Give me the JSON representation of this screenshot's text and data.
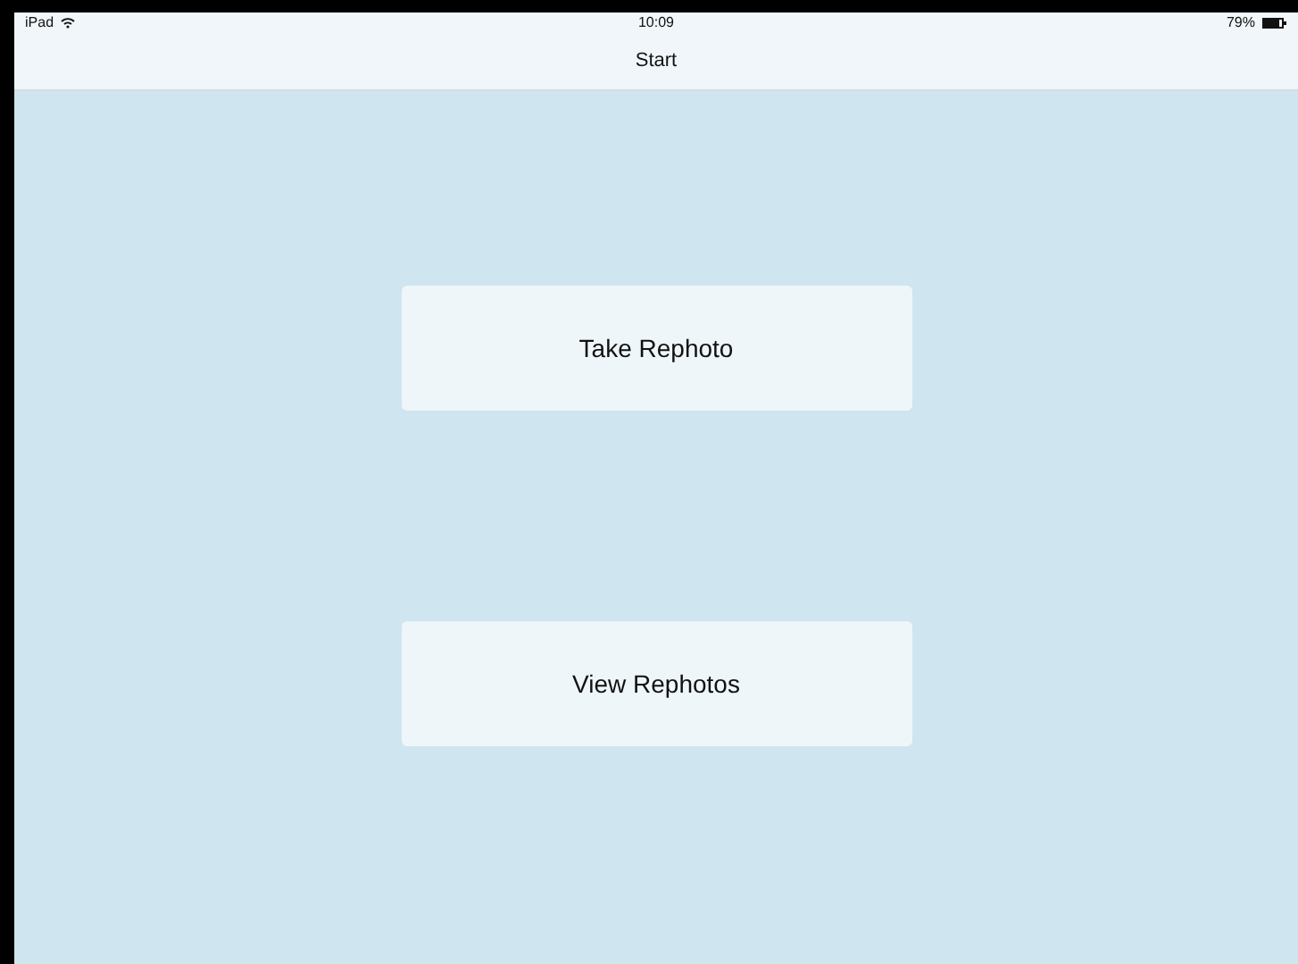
{
  "status_bar": {
    "device": "iPad",
    "time": "10:09",
    "battery": "79%"
  },
  "nav_bar": {
    "title": "Start"
  },
  "buttons": [
    {
      "label": "Take Rephoto"
    },
    {
      "label": "View Rephotos"
    }
  ]
}
